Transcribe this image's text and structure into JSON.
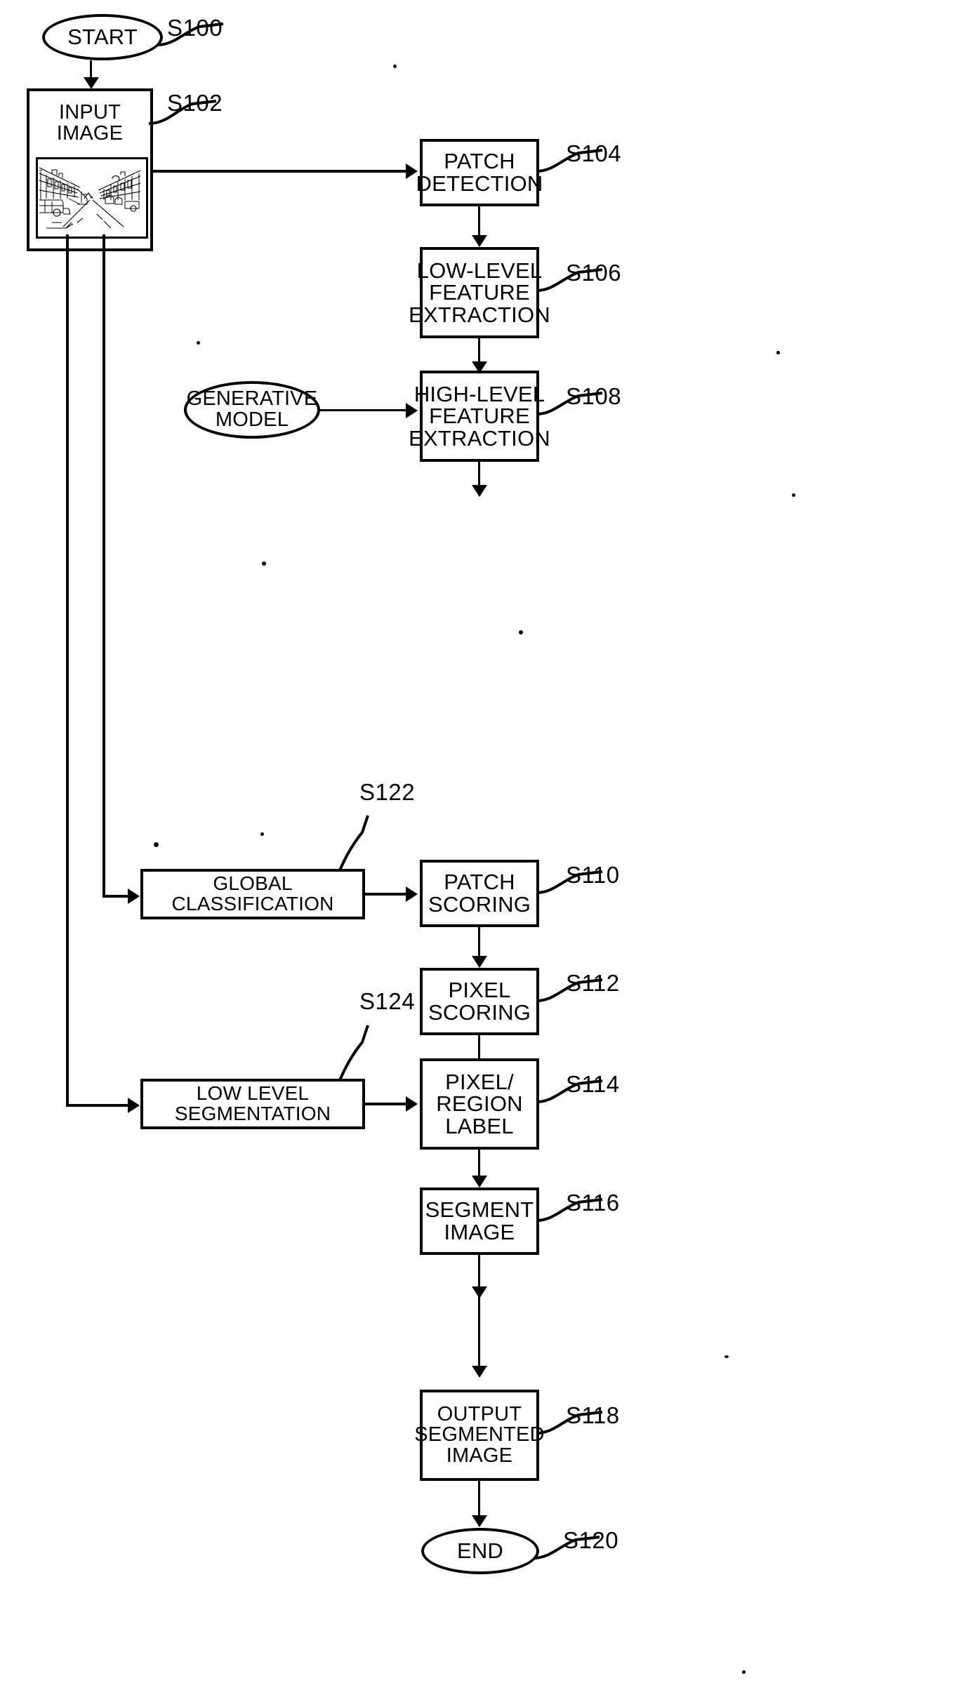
{
  "figure": {
    "type": "patent-flowchart",
    "orientation": "portrait"
  },
  "nodes": {
    "start": {
      "label": "START",
      "shape": "ellipse",
      "ref": "S100"
    },
    "input_image": {
      "label": "INPUT IMAGE",
      "shape": "box",
      "ref": "S102"
    },
    "patch_detect": {
      "label": "PATCH\nDETECTION",
      "shape": "box",
      "ref": "S104"
    },
    "low_feat": {
      "label": "LOW-LEVEL\nFEATURE\nEXTRACTION",
      "shape": "box",
      "ref": "S106"
    },
    "high_feat": {
      "label": "HIGH-LEVEL\nFEATURE\nEXTRACTION",
      "shape": "box",
      "ref": "S108"
    },
    "gen_model": {
      "label": "GENERATIVE\nMODEL",
      "shape": "ellipse",
      "ref": ""
    },
    "global_class": {
      "label": "GLOBAL CLASSIFICATION",
      "shape": "box",
      "ref": "S122"
    },
    "patch_score": {
      "label": "PATCH\nSCORING",
      "shape": "box",
      "ref": "S110"
    },
    "pixel_score": {
      "label": "PIXEL\nSCORING",
      "shape": "box",
      "ref": "S112"
    },
    "low_seg": {
      "label": "LOW LEVEL SEGMENTATION",
      "shape": "box",
      "ref": "S124"
    },
    "pixel_label": {
      "label": "PIXEL/\nREGION\nLABEL",
      "shape": "box",
      "ref": "S114"
    },
    "segment_img": {
      "label": "SEGMENT\nIMAGE",
      "shape": "box",
      "ref": "S116"
    },
    "output_img": {
      "label": "OUTPUT\nSEGMENTED\nIMAGE",
      "shape": "box",
      "ref": "S118"
    },
    "end": {
      "label": "END",
      "shape": "ellipse",
      "ref": "S120"
    }
  },
  "refs": {
    "s100": "S100",
    "s102": "S102",
    "s104": "S104",
    "s106": "S106",
    "s108": "S108",
    "s110": "S110",
    "s112": "S112",
    "s114": "S114",
    "s116": "S116",
    "s118": "S118",
    "s120": "S120",
    "s122": "S122",
    "s124": "S124"
  },
  "thumbnail": {
    "name": "street-scene-line-drawing",
    "description": "line drawing of a street receding to a vanishing point with buildings on both sides and a vehicle at lower left"
  },
  "colors": {
    "ink": "#000000",
    "paper": "#ffffff"
  }
}
